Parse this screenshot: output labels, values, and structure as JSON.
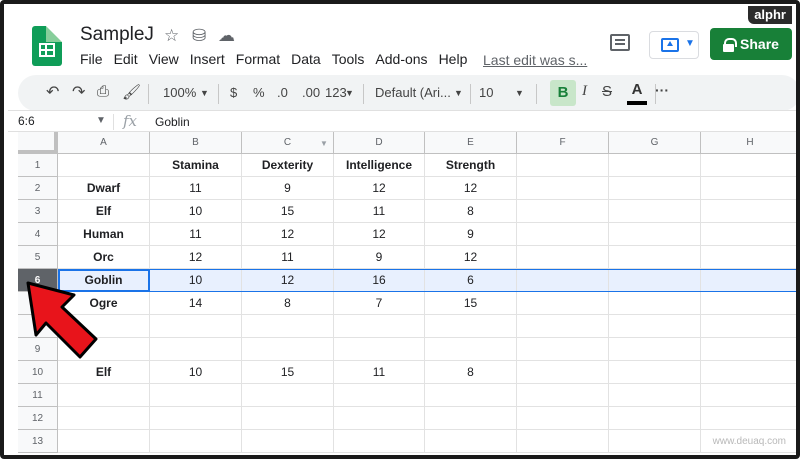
{
  "watermark": "alphr",
  "watermark_bottom": "www.deuaq.com",
  "doc": {
    "title": "SampleJ",
    "last_edit": "Last edit was s..."
  },
  "menu": [
    "File",
    "Edit",
    "View",
    "Insert",
    "Format",
    "Data",
    "Tools",
    "Add-ons",
    "Help"
  ],
  "share_label": "Share",
  "toolbar": {
    "zoom": "100%",
    "currency": "$",
    "percent": "%",
    "decrease_decimal": ".0",
    "increase_decimal": ".00",
    "more_formats": "123",
    "font": "Default (Ari...",
    "font_size": "10",
    "bold": "B",
    "italic": "I",
    "strike": "S",
    "text_color": "A",
    "more": "···"
  },
  "formula_bar": {
    "cell_ref": "6:6",
    "fx": "fx",
    "value": "Goblin"
  },
  "columns": [
    "A",
    "B",
    "C",
    "D",
    "E",
    "F",
    "G",
    "H"
  ],
  "rows": [
    [
      "",
      "Stamina",
      "Dexterity",
      "Intelligence",
      "Strength",
      "",
      "",
      ""
    ],
    [
      "Dwarf",
      "11",
      "9",
      "12",
      "12",
      "",
      "",
      ""
    ],
    [
      "Elf",
      "10",
      "15",
      "11",
      "8",
      "",
      "",
      ""
    ],
    [
      "Human",
      "11",
      "12",
      "12",
      "9",
      "",
      "",
      ""
    ],
    [
      "Orc",
      "12",
      "11",
      "9",
      "12",
      "",
      "",
      ""
    ],
    [
      "Goblin",
      "10",
      "12",
      "16",
      "6",
      "",
      "",
      ""
    ],
    [
      "Ogre",
      "14",
      "8",
      "7",
      "15",
      "",
      "",
      ""
    ],
    [
      "",
      "",
      "",
      "",
      "",
      "",
      "",
      ""
    ],
    [
      "",
      "",
      "",
      "",
      "",
      "",
      "",
      ""
    ],
    [
      "Elf",
      "10",
      "15",
      "11",
      "8",
      "",
      "",
      ""
    ],
    [
      "",
      "",
      "",
      "",
      "",
      "",
      "",
      ""
    ],
    [
      "",
      "",
      "",
      "",
      "",
      "",
      "",
      ""
    ],
    [
      "",
      "",
      "",
      "",
      "",
      "",
      "",
      ""
    ]
  ],
  "selected_row": 6,
  "colors": {
    "accent": "#1a73e8",
    "share": "#188038",
    "arrow": "#e8141b"
  }
}
